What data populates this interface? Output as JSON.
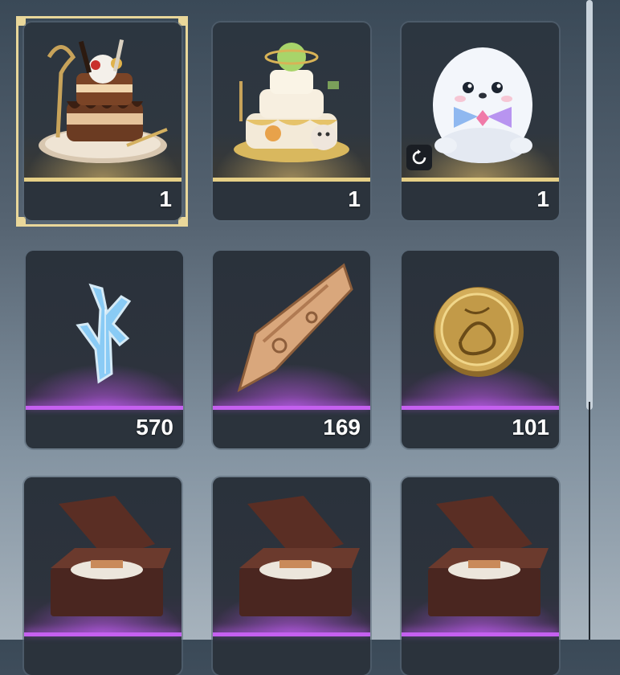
{
  "inventory": {
    "items": [
      {
        "name": "Chocolate Birthday Cake",
        "count": "1",
        "rarity": "gold",
        "selected": true
      },
      {
        "name": "Planet Party Cake",
        "count": "1",
        "rarity": "gold"
      },
      {
        "name": "Seal Plush",
        "count": "1",
        "rarity": "gold",
        "badge": "refresh-icon"
      },
      {
        "name": "Ice Crystal Coral",
        "count": "570",
        "rarity": "purple"
      },
      {
        "name": "Bronze Relic Fragment",
        "count": "169",
        "rarity": "purple"
      },
      {
        "name": "Gold Emblem Coin",
        "count": "101",
        "rarity": "purple"
      },
      {
        "name": "Music Box",
        "count": "",
        "rarity": "purple"
      },
      {
        "name": "Music Box",
        "count": "",
        "rarity": "purple"
      },
      {
        "name": "Music Box",
        "count": "",
        "rarity": "purple"
      }
    ]
  },
  "colors": {
    "gold": "#e6cf86",
    "purple": "#c560f0",
    "card": "#2b333c"
  }
}
